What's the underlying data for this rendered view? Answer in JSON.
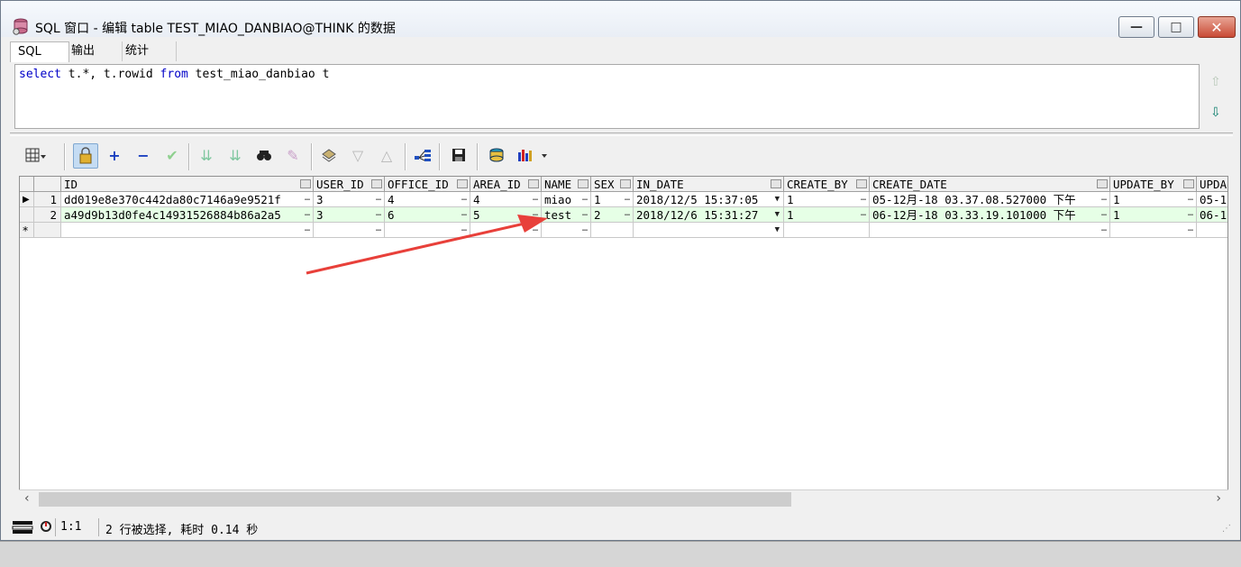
{
  "window": {
    "title": "SQL 窗口 - 编辑 table TEST_MIAO_DANBIAO@THINK 的数据",
    "minimize_glyph": "—",
    "maximize_glyph": "□",
    "close_glyph": "✕"
  },
  "tabs": [
    "SQL",
    "输出",
    "统计"
  ],
  "editor": {
    "sql_select": "select",
    "sql_mid": " t.*, t.rowid ",
    "sql_from": "from",
    "sql_end": " test_miao_danbiao t"
  },
  "toolbar": {
    "grid_icon": "grid-icon",
    "lock_icon": "lock-icon",
    "add": "+",
    "remove": "−",
    "post": "✔",
    "find": "find-icon",
    "clear": "clear-icon",
    "query_by_example": "query-icon",
    "save": "save-icon",
    "export": "export-icon",
    "chart": "chart-icon"
  },
  "grid": {
    "columns": [
      "ID",
      "USER_ID",
      "OFFICE_ID",
      "AREA_ID",
      "NAME",
      "SEX",
      "IN_DATE",
      "CREATE_BY",
      "CREATE_DATE",
      "UPDATE_BY",
      "UPDA"
    ],
    "rows": [
      {
        "num": "1",
        "indicator": "▶",
        "ID": "dd019e8e370c442da80c7146a9e9521f",
        "USER_ID": "3",
        "OFFICE_ID": "4",
        "AREA_ID": "4",
        "NAME": "miao",
        "SEX": "1",
        "IN_DATE": "2018/12/5 15:37:05",
        "CREATE_BY": "1",
        "CREATE_DATE": "05-12月-18 03.37.08.527000 下午",
        "UPDATE_BY": "1",
        "UPDA": "05-1"
      },
      {
        "num": "2",
        "indicator": "",
        "ID": "a49d9b13d0fe4c14931526884b86a2a5",
        "USER_ID": "3",
        "OFFICE_ID": "6",
        "AREA_ID": "5",
        "NAME": "test",
        "SEX": "2",
        "IN_DATE": "2018/12/6 15:31:27",
        "CREATE_BY": "1",
        "CREATE_DATE": "06-12月-18 03.33.19.101000 下午",
        "UPDATE_BY": "1",
        "UPDA": "06-1"
      }
    ],
    "new_row_indicator": "*"
  },
  "status": {
    "position": "1:1",
    "message": "2 行被选择, 耗时 0.14 秒"
  },
  "colors": {
    "selected_row": "#e6ffe6",
    "arrow": "#e8403a",
    "keyword": "#0000c8"
  }
}
